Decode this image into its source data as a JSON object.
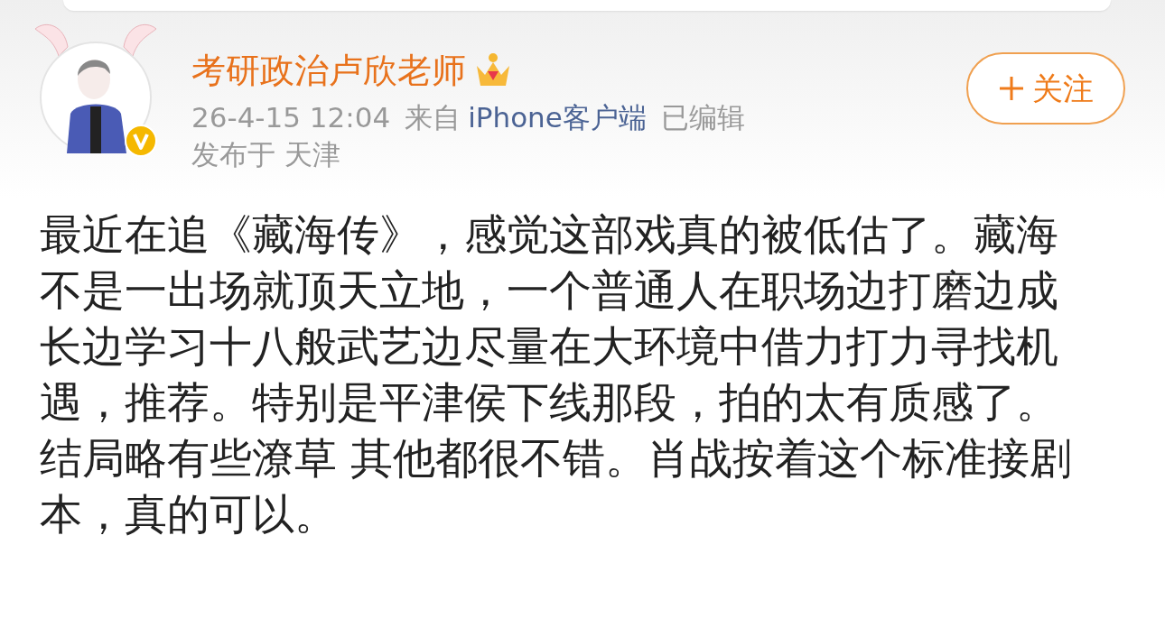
{
  "post": {
    "author": {
      "name": "考研政治卢欣老师",
      "verified": true
    },
    "meta": {
      "time": "26-4-15 12:04",
      "source_prefix": "来自",
      "source": "iPhone客户端",
      "edited": "已编辑",
      "location": "发布于 天津"
    },
    "follow_button": {
      "label": "关注"
    },
    "text": "最近在追《藏海传》，感觉这部戏真的被低估了。藏海不是一出场就顶天立地，一个普通人在职场边打磨边成长边学习十八般武艺边尽量在大环境中借力打力寻找机遇，推荐。特别是平津侯下线那段，拍的太有质感了。结局略有些潦草 其他都很不错。肖战按着这个标准接剧本，真的可以。"
  }
}
